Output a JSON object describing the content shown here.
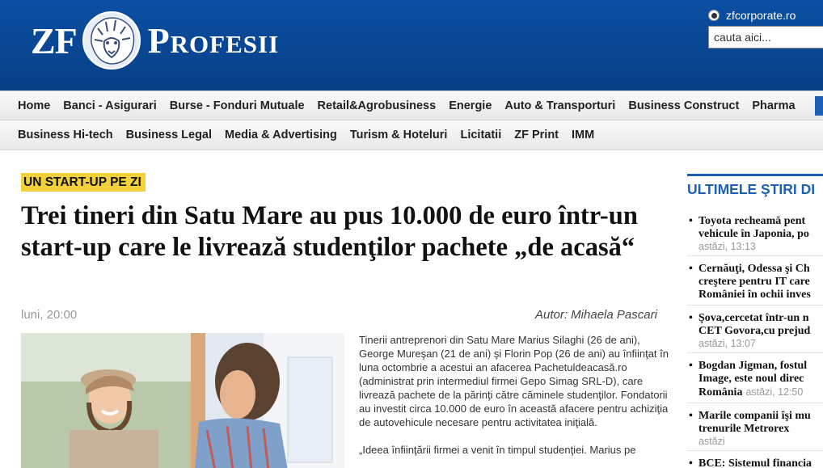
{
  "header": {
    "logo_left": "ZF",
    "logo_right": "Profesii",
    "corporate_link": "zfcorporate.ro",
    "search_placeholder": "cauta aici..."
  },
  "nav_primary": [
    "Home",
    "Banci - Asigurari",
    "Burse - Fonduri Mutuale",
    "Retail&Agrobusiness",
    "Energie",
    "Auto & Transporturi",
    "Business Construct",
    "Pharma"
  ],
  "nav_secondary": [
    "Business Hi-tech",
    "Business Legal",
    "Media & Advertising",
    "Turism & Hoteluri",
    "Licitatii",
    "ZF Print",
    "IMM"
  ],
  "article": {
    "kicker": "UN START-UP PE ZI",
    "headline": "Trei tineri din Satu Mare au pus 10.000 de euro într-un start-up care le livrează studenţilor pachete „de acasă“",
    "date": "luni, 20:00",
    "author": "Autor: Mihaela Pascari",
    "paragraph1": "Tinerii antreprenori din Satu Mare Marius Silaghi (26 de ani), George Mureşan (21 de ani) şi Florin Pop (26 de ani) au înfiinţat în luna octombrie a acestui an afacerea Pachetuldeacasă.ro (administrat prin intermediul firmei Gepo Simag SRL-D), care livrează pachete de la părinţi către căminele studenţilor. Fondatorii au investit circa 10.000 de euro în această afacere pentru achiziţia de autovehicule necesare pentru activitatea iniţială.",
    "paragraph2": "„Ideea înfiinţării firmei a venit în timpul studenţiei. Marius pe"
  },
  "sidebar": {
    "title": "ULTIMELE ŞTIRI DI",
    "items": [
      {
        "line1": "Toyota recheamă pent",
        "line2": "vehicule în Japonia, po",
        "line3": "",
        "time": "astăzi, 13:13"
      },
      {
        "line1": "Cernăuţi, Odessa şi Ch",
        "line2": "creştere pentru IT care",
        "line3": "României în ochii inves",
        "time": ""
      },
      {
        "line1": "Şova,cercetat într-un n",
        "line2": "CET Govora,cu prejud",
        "line3": "",
        "time": "astăzi, 13:07"
      },
      {
        "line1": "Bogdan Jigman, fostul",
        "line2": "Image, este noul direc",
        "line3": "România",
        "time": "astăzi, 12:50"
      },
      {
        "line1": "Marile companii îşi mu",
        "line2": "trenurile Metrorex",
        "line3": "",
        "time": "astăzi"
      },
      {
        "line1": "BCE: Sistemul financia",
        "line2": "",
        "line3": "",
        "time": ""
      }
    ]
  }
}
